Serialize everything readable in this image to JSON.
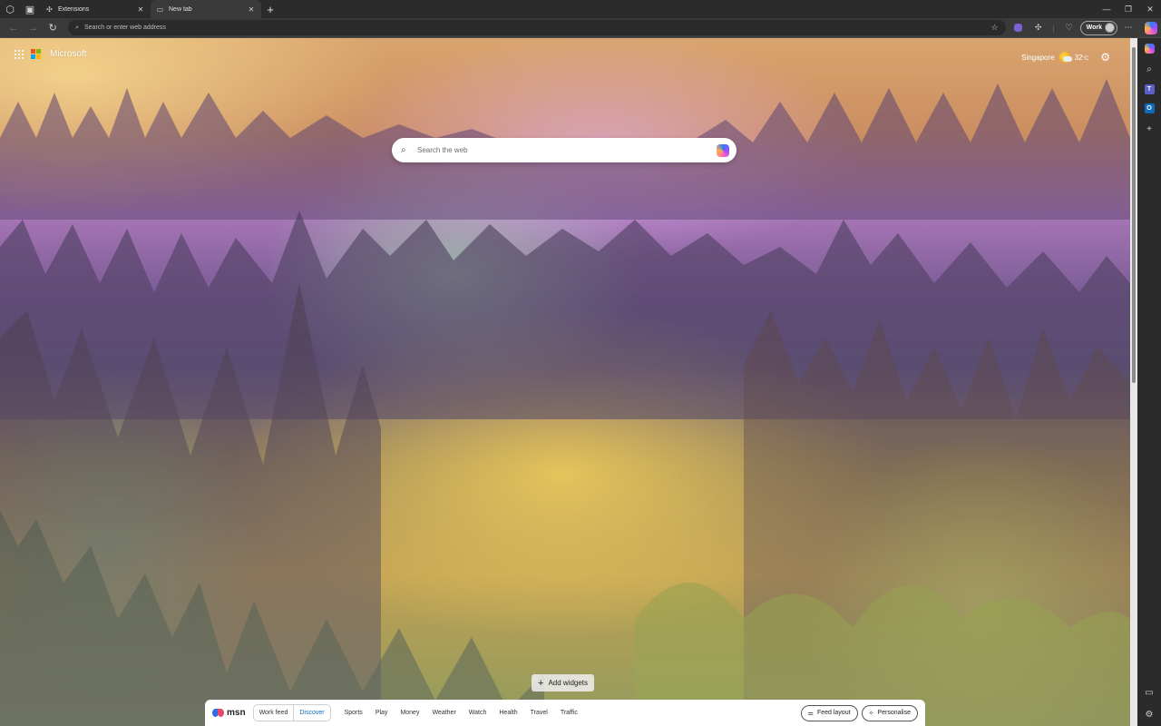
{
  "browser": {
    "tabs": [
      {
        "label": "Extensions",
        "icon": "puzzle-icon",
        "active": false
      },
      {
        "label": "New tab",
        "icon": "page-icon",
        "active": true
      }
    ],
    "address_placeholder": "Search or enter web address",
    "profile_label": "Work"
  },
  "newtab": {
    "brand": "Microsoft",
    "weather": {
      "city": "Singapore",
      "temp": "32",
      "unit": "°C"
    },
    "search_placeholder": "Search the web",
    "add_widgets_label": "Add widgets"
  },
  "msn": {
    "logo_text": "msn",
    "feed_tabs": [
      "Work feed",
      "Discover"
    ],
    "categories": [
      "Sports",
      "Play",
      "Money",
      "Weather",
      "Watch",
      "Health",
      "Travel",
      "Traffic"
    ],
    "feed_layout_label": "Feed layout",
    "personalise_label": "Personalise"
  },
  "colors": {
    "ms_red": "#f25022",
    "ms_green": "#7fba00",
    "ms_blue": "#00a4ef",
    "ms_yellow": "#ffb900",
    "accent": "#0f6cbd"
  }
}
